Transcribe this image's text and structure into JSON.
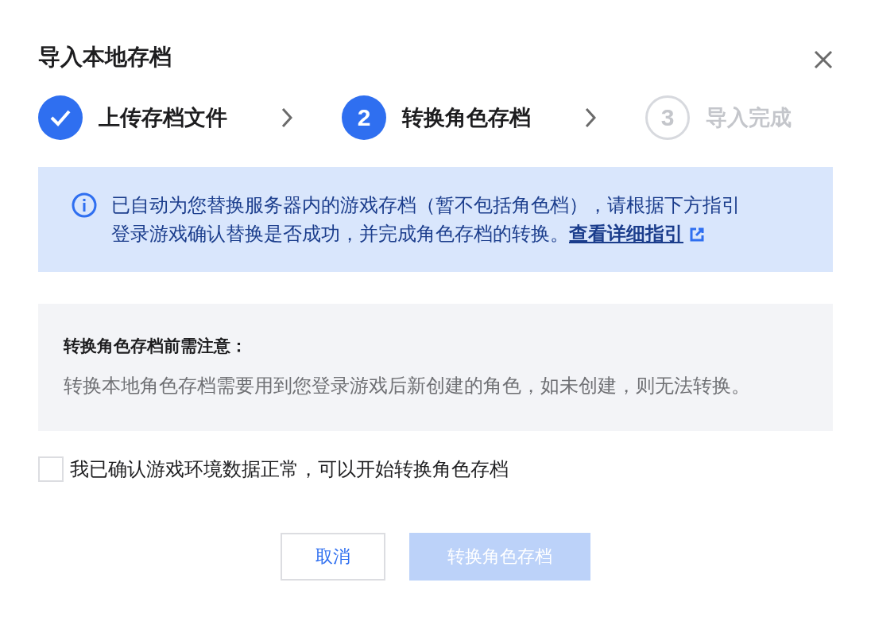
{
  "dialog": {
    "title": "导入本地存档"
  },
  "steps": [
    {
      "label": "上传存档文件",
      "done": true,
      "selected": false
    },
    {
      "number": "2",
      "label": "转换角色存档",
      "done": false,
      "selected": true
    },
    {
      "number": "3",
      "label": "导入完成",
      "done": false,
      "selected": false
    }
  ],
  "info": {
    "line_1": "已自动为您替换服务器内的游戏存档（暂不包括角色档），请根据下方指引",
    "line_2": "登录游戏确认替换是否成功，并完成角色存档的转换。",
    "link": "查看详细指引"
  },
  "notice": {
    "title": "转换角色存档前需注意：",
    "text": "转换本地角色存档需要用到您登录游戏后新创建的角色，如未创建，则无法转换。"
  },
  "confirm": {
    "label": "我已确认游戏环境数据正常，可以开始转换角色存档",
    "checked": false
  },
  "buttons": [
    {
      "label": "取消",
      "kind": "secondary",
      "disabled": false
    },
    {
      "label": "转换角色存档",
      "kind": "primary",
      "disabled": true
    }
  ]
}
